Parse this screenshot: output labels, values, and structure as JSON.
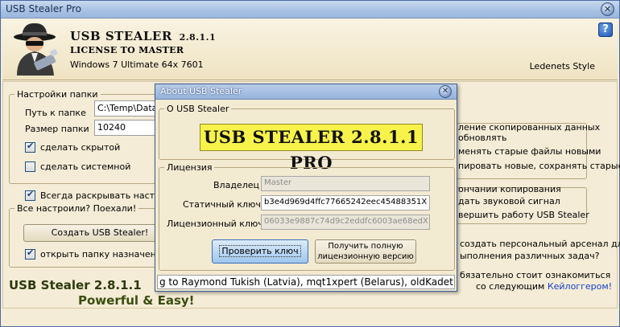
{
  "window": {
    "title": "USB Stealer Pro",
    "close_glyph": "✕"
  },
  "header": {
    "app_name": "USB STEALER",
    "version": "2.8.1.1",
    "license": "LICENSE TO MASTER",
    "os_info": "Windows 7 Ultimate 64x 7601",
    "style_name": "Ledenets Style",
    "help_glyph": "?"
  },
  "folder_settings": {
    "legend": "Настройки  папки",
    "path_label": "Путь к папке",
    "path_value": "C:\\Temp\\Data",
    "size_label": "Размер папки",
    "size_value": "10240",
    "hidden_label": "сделать скрытой",
    "hidden_checked": true,
    "system_label": "сделать системной",
    "system_checked": false
  },
  "always_expand": {
    "label": "Всегда раскрывать настрой",
    "checked": true
  },
  "create_group": {
    "legend": "Все настроили? Поехали!",
    "create_button": "Создать USB Stealer!",
    "open_folder_label": "открыть папку  назначения",
    "open_folder_checked": true
  },
  "bottom": {
    "name": "USB Stealer 2.8.1.1",
    "tagline": "Powerful & Easy!"
  },
  "right_panel": {
    "line1": "ление скопированных данных",
    "line2": "обновлять",
    "line3": "менять старые файлы новыми",
    "line4": "пировать новые, сохранять старые",
    "line5": "ончании копирования",
    "line6": "дать звуковой сигнал",
    "line7": "вершить работу USB Stealer",
    "line8": "создать персональный арсенал для",
    "line9": "ыполнения различных задач?",
    "line10": "бязательно стоит ознакомиться",
    "line11": "со следующим",
    "link": "Кейлоггером!"
  },
  "about_dialog": {
    "title": "About USB Stealer",
    "close_glyph": "✕",
    "about_legend": "О USB Stealer",
    "banner": "USB STEALER 2.8.1.1 PRO",
    "license_legend": "Лицензия",
    "owner_label": "Владелец",
    "owner_value": "Master",
    "static_key_label": "Статичный ключ",
    "static_key_value": "b3e4d969d4ffc77665242eec45488351X",
    "license_key_label": "Лицензионный ключ",
    "license_key_value": "06033e9887c74d9c2eddfc6003ae68edX",
    "verify_button": "Проверить ключ",
    "full_version_line1": "Получить полную",
    "full_version_line2": "лицензионную версию",
    "ticker": "g to Raymond Tukish (Latvia), mqt1xpert (Belarus), oldKadet"
  }
}
